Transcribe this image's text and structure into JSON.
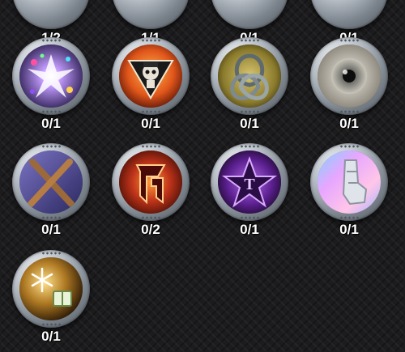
{
  "top_row_counts": [
    "1/2",
    "1/1",
    "0/1",
    "0/1"
  ],
  "items": [
    {
      "icon": "crystal-burst-icon",
      "count": "0/1",
      "accent": "#6a3fb5"
    },
    {
      "icon": "skull-triangle-icon",
      "count": "0/1",
      "accent": "#e0561b"
    },
    {
      "icon": "celtic-knot-icon",
      "count": "0/1",
      "accent": "#8a7a2c"
    },
    {
      "icon": "eye-icon",
      "count": "0/1",
      "accent": "#b9b4a6"
    },
    {
      "icon": "crossed-sticks-icon",
      "count": "0/1",
      "accent": "#4b4a8c"
    },
    {
      "icon": "r-emblem-icon",
      "count": "0/2",
      "accent": "#c0341a"
    },
    {
      "icon": "pentagram-emblem-icon",
      "count": "0/1",
      "accent": "#6d2fa3"
    },
    {
      "icon": "holographic-arm-icon",
      "count": "0/1",
      "accent": "#b88ad6"
    },
    {
      "icon": "snowflake-gift-icon",
      "count": "0/1",
      "accent": "#b07a24"
    }
  ]
}
